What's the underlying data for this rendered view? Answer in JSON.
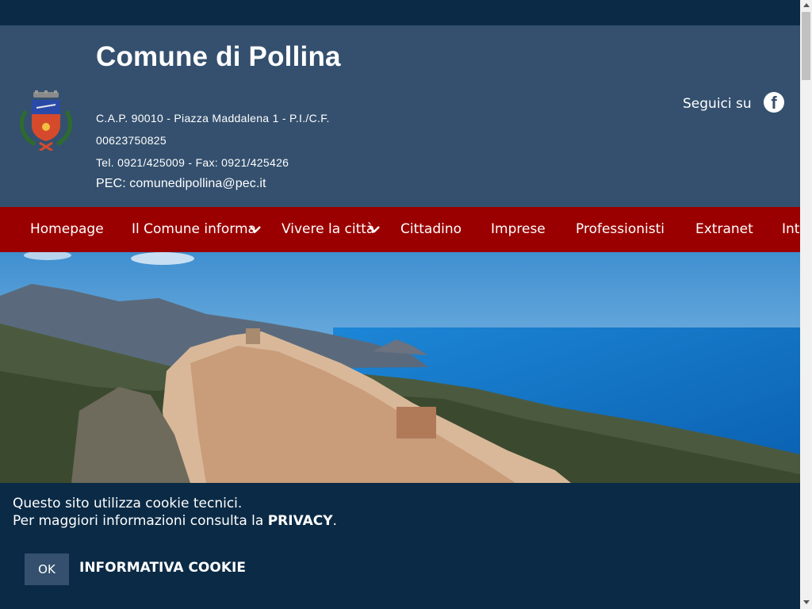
{
  "header": {
    "title": "Comune di Pollina",
    "address_line1": "C.A.P. 90010 - Piazza Maddalena 1 - P.I./C.F.",
    "address_line2": "00623750825",
    "phone_fax": "Tel. 0921/425009 - Fax: 0921/425426",
    "pec": "PEC: comunedipollina@pec.it",
    "follow_label": "Seguici su",
    "logo_icon": "municipal-crest-icon",
    "social_icon": "facebook-icon",
    "social_glyph": "f"
  },
  "nav": {
    "items": [
      {
        "label": "Homepage",
        "has_dropdown": false
      },
      {
        "label": "Il Comune informa",
        "has_dropdown": true
      },
      {
        "label": "Vivere la città",
        "has_dropdown": true
      },
      {
        "label": "Cittadino",
        "has_dropdown": false
      },
      {
        "label": "Imprese",
        "has_dropdown": false
      },
      {
        "label": "Professionisti",
        "has_dropdown": false
      },
      {
        "label": "Extranet",
        "has_dropdown": false
      },
      {
        "label": "Int",
        "has_dropdown": false
      }
    ]
  },
  "cookie_banner": {
    "line1": "Questo sito utilizza cookie tecnici.",
    "line2_prefix": "Per maggiori informazioni consulta la ",
    "privacy_link": "PRIVACY",
    "line2_suffix": ".",
    "ok_label": "OK",
    "info_link": "INFORMATIVA COOKIE"
  },
  "colors": {
    "topbar": "#0b2a45",
    "header": "#34506e",
    "nav": "#9b0000",
    "cookie_bg": "#0b2a45"
  }
}
